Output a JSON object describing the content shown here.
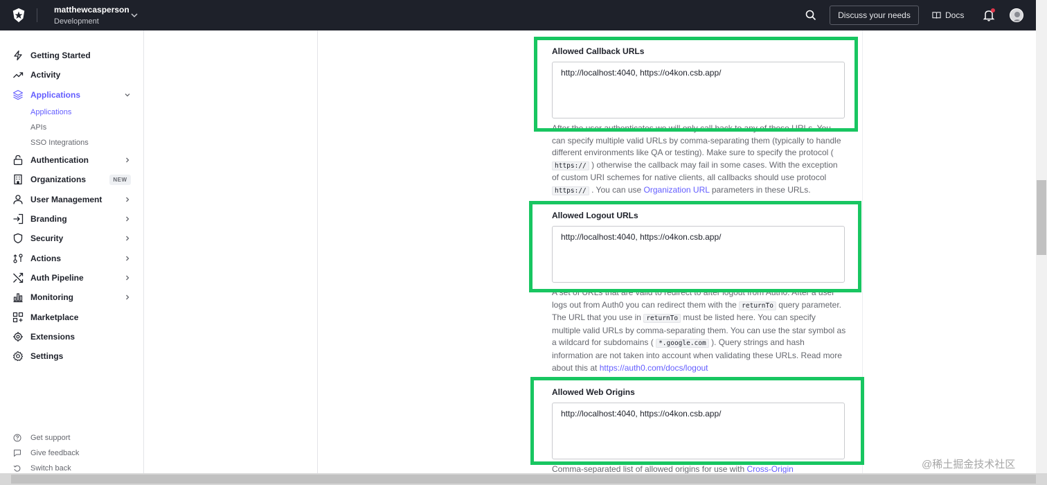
{
  "topbar": {
    "tenant_name": "matthewcasperson",
    "tenant_env": "Development",
    "discuss_label": "Discuss your needs",
    "docs_label": "Docs",
    "bg_color": "#1e212a",
    "icons": [
      "auth0-logo-icon",
      "chevron-down-icon",
      "search-icon",
      "book-icon",
      "bell-icon",
      "avatar"
    ]
  },
  "sidebar": {
    "items": [
      {
        "label": "Getting Started",
        "icon": "lightning-icon"
      },
      {
        "label": "Activity",
        "icon": "trend-icon"
      },
      {
        "label": "Applications",
        "icon": "layers-icon",
        "active": true
      },
      {
        "label": "Authentication",
        "icon": "lock-icon"
      },
      {
        "label": "Organizations",
        "icon": "building-icon",
        "badge": "NEW"
      },
      {
        "label": "User Management",
        "icon": "user-icon"
      },
      {
        "label": "Branding",
        "icon": "branding-icon"
      },
      {
        "label": "Security",
        "icon": "shield-icon"
      },
      {
        "label": "Actions",
        "icon": "actions-icon"
      },
      {
        "label": "Auth Pipeline",
        "icon": "pipeline-icon"
      },
      {
        "label": "Monitoring",
        "icon": "bar-chart-icon"
      },
      {
        "label": "Marketplace",
        "icon": "grid-plus-icon"
      },
      {
        "label": "Extensions",
        "icon": "extensions-icon"
      },
      {
        "label": "Settings",
        "icon": "gear-icon"
      }
    ],
    "subitems": [
      {
        "label": "Applications",
        "active": true
      },
      {
        "label": "APIs"
      },
      {
        "label": "SSO Integrations"
      }
    ],
    "footer": [
      {
        "label": "Get support",
        "icon": "help-icon"
      },
      {
        "label": "Give feedback",
        "icon": "feedback-icon"
      },
      {
        "label": "Switch back",
        "icon": "switch-back-icon"
      }
    ],
    "accent_color": "#635dff"
  },
  "callback": {
    "label": "Allowed Callback URLs",
    "value": "http://localhost:4040, https://o4kon.csb.app/",
    "help_1": "After the user authenticates we will only call back to any of these URLs. You can specify multiple valid URLs by comma-separating them (typically to handle different environments like QA or testing). Make sure to specify the protocol (",
    "code_1": "https://",
    "help_2": ") otherwise the callback may fail in some cases. With the exception of custom URI schemes for native clients, all callbacks should use protocol",
    "code_2": "https://",
    "help_3": ". You can use",
    "link": "Organization URL",
    "help_4": "parameters in these URLs."
  },
  "logout": {
    "label": "Allowed Logout URLs",
    "value": "http://localhost:4040, https://o4kon.csb.app/",
    "help_1": "A set of URLs that are valid to redirect to after logout from Auth0. After a user logs out from Auth0 you can redirect them with the",
    "code_1": "returnTo",
    "help_2": "query parameter. The URL that you use in",
    "code_2": "returnTo",
    "help_3": "must be listed here. You can specify multiple valid URLs by comma-separating them. You can use the star symbol as a wildcard for subdomains (",
    "code_3": "*.google.com",
    "help_4": "). Query strings and hash information are not taken into account when validating these URLs. Read more about this at",
    "link": "https://auth0.com/docs/logout"
  },
  "web_origins": {
    "label": "Allowed Web Origins",
    "value": "http://localhost:4040, https://o4kon.csb.app/",
    "help_1": "Comma-separated list of allowed origins for use with",
    "link": "Cross-Origin"
  },
  "highlight_color": "#18c661",
  "watermark": "@稀土掘金技术社区"
}
